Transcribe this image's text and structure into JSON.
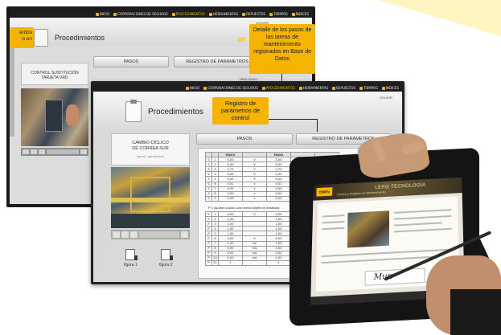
{
  "nav": {
    "items": [
      "INICIO",
      "CORPORACIONES DE SEGUROS",
      "PROCEDIMIENTOS",
      "HERRAMIENTAS",
      "REPUESTOS",
      "TIEMPOS",
      "ÍNDICES"
    ],
    "active_index": 2
  },
  "back": {
    "title": "Procedimientos",
    "cut_callout": "entos\no en",
    "volver": "VOLVER",
    "tab_pasos": "PASOS",
    "tab_registro": "REGISTRO DE PARÁMETROS",
    "card": "CONTROL SUSTITUCIÓN\nTARJETA VRD",
    "realizado": "REALIZADO"
  },
  "callouts": {
    "big": "Detalle de los pasos de las tareas de mantenimiento registrados en Base de Datos",
    "small": "Registro de parámetros de control"
  },
  "front": {
    "title": "Procedimientos",
    "volver": "VOLVER",
    "tab_pasos": "PASOS",
    "tab_registro": "REGISTRO DE PARÁMETROS",
    "card_title": "CAMBIO CÍCLICO\nDE CORREA SUR",
    "card_sub": "pasos / parámetros",
    "fig1": "figura 1",
    "fig2": "figura 2",
    "mid_text": "P 1 Ajustar cuando una nueva tarjeta es instalada",
    "table1_head": [
      "",
      "",
      "MAX1",
      "",
      "MAX2",
      "",
      ""
    ],
    "table1_rows": [
      [
        "S",
        "1",
        "0,00",
        "V",
        "0,00",
        "V",
        "0,"
      ],
      [
        "S",
        "2",
        "0,00",
        "V",
        "0,00",
        "V",
        "0,"
      ],
      [
        "S",
        "3",
        "0,75",
        "V",
        "0,75",
        "V",
        "0,"
      ],
      [
        "S",
        "4",
        "0,00",
        "V",
        "0,00",
        "V",
        "0,"
      ],
      [
        "S",
        "5",
        "0,00",
        "V",
        "0,00",
        "V",
        "0,"
      ],
      [
        "S",
        "6",
        "0,01",
        "s",
        "0,01",
        "s",
        "0,"
      ],
      [
        "S",
        "7",
        "0,50",
        "s",
        "0,50",
        "s",
        "0,"
      ],
      [
        "S",
        "8",
        "0,00",
        "s",
        "0,00",
        "s",
        "0,"
      ],
      [
        "S",
        "9",
        "0,00",
        "s",
        "0,00",
        "s",
        "0,"
      ]
    ],
    "table2_rows": [
      [
        "P",
        "1",
        "0,00",
        "V",
        "0,00",
        "V",
        "1,"
      ],
      [
        "P",
        "2",
        "1,00",
        "",
        "1,00",
        "",
        "1,"
      ],
      [
        "P",
        "3",
        "1,00",
        "",
        "1,00",
        "",
        "1,"
      ],
      [
        "P",
        "4",
        "1,00",
        "",
        "1,00",
        "",
        "1,"
      ],
      [
        "P",
        "5",
        "1,00",
        "",
        "1,00",
        "",
        "1,"
      ],
      [
        "P",
        "6",
        "0,00",
        "V",
        "0,00",
        "V",
        "1,"
      ],
      [
        "P",
        "7",
        "1,00",
        "Hz",
        "1,00",
        "Hz",
        "1,"
      ],
      [
        "P",
        "8",
        "0,00",
        "mA",
        "0,00",
        "mA",
        "0,"
      ],
      [
        "P",
        "9",
        "0,00",
        "mA",
        "0,00",
        "mA",
        "0,"
      ],
      [
        "P",
        "10",
        "0,00",
        "mA",
        "0,00",
        "mA",
        "0,"
      ],
      [
        "P",
        "11",
        "1",
        "",
        "1",
        "",
        "1"
      ]
    ]
  },
  "tablet": {
    "logo": "EMEN",
    "title": "LEPO TECNOLOGÍA",
    "subtitle": "Control y Registro de Mantenimiento",
    "signature": "Mun"
  }
}
